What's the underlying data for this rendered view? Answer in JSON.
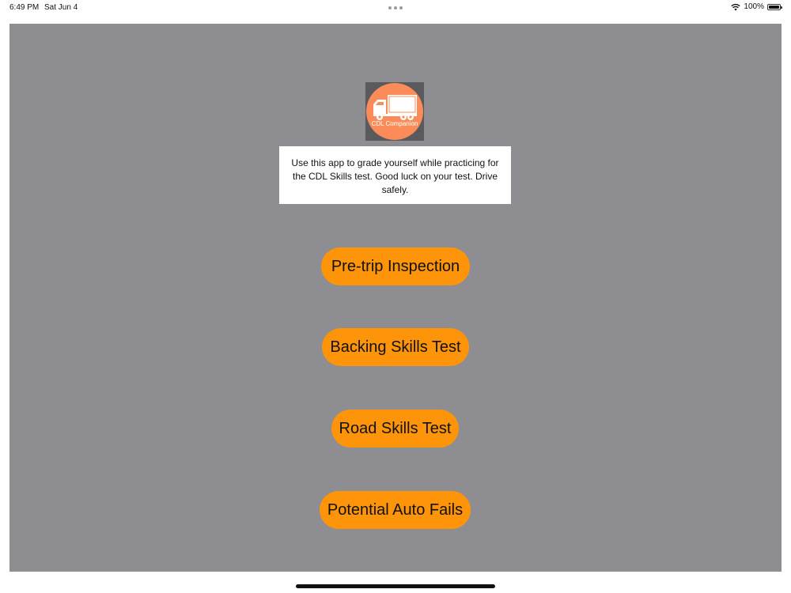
{
  "status_bar": {
    "time": "6:49 PM",
    "date": "Sat Jun 4",
    "battery": "100%",
    "icons": [
      "wifi-icon",
      "battery-icon"
    ]
  },
  "logo": {
    "text": "CDL Companion",
    "icon": "truck-icon",
    "circle_color": "#fb8c5a"
  },
  "intro_text": "Use this app to grade yourself while practicing for the CDL Skills test. Good luck on your test. Drive safely.",
  "menu": {
    "buttons": [
      {
        "label": "Pre-trip Inspection"
      },
      {
        "label": "Backing Skills Test"
      },
      {
        "label": "Road Skills Test"
      },
      {
        "label": "Potential Auto Fails"
      }
    ],
    "button_color": "#fd9409"
  },
  "colors": {
    "background": "#8e8d92"
  }
}
